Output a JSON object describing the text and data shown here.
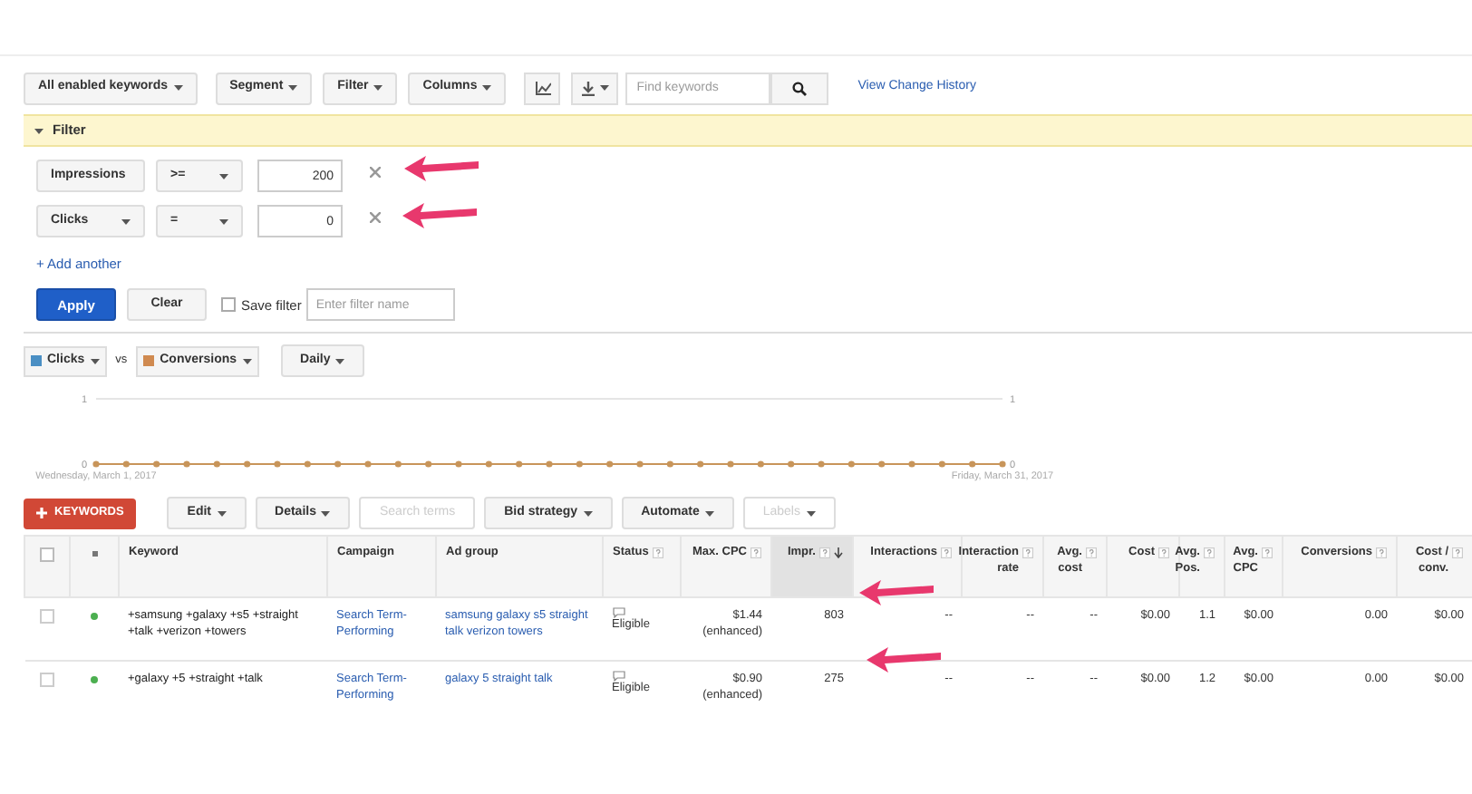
{
  "toolbar": {
    "view": "All enabled keywords",
    "buttons": [
      "Segment",
      "Filter",
      "Columns"
    ],
    "search": {
      "placeholder": "Find keywords"
    },
    "link": "View Change History"
  },
  "filter_panel": {
    "title": "Filter",
    "expanded": true,
    "rows": [
      {
        "field": "Impressions",
        "operator": ">=",
        "value": "200"
      },
      {
        "field": "Clicks",
        "operator": "=",
        "value": "0"
      }
    ],
    "add_link": "+ Add another",
    "apply": "Apply",
    "clear": "Clear",
    "save": {
      "label": "Save filter",
      "checked": false,
      "placeholder": "Enter filter name"
    }
  },
  "chart_controls": {
    "metric_1": {
      "label": "Clicks",
      "color": "#4a8fc4"
    },
    "vs": "vs",
    "metric_2": {
      "label": "Conversions",
      "color": "#d08a50"
    },
    "period": "Daily"
  },
  "chart_data": {
    "type": "line",
    "categories": [
      "Wednesday, March 1, 2017",
      null,
      null,
      null,
      null,
      null,
      null,
      null,
      null,
      null,
      null,
      null,
      null,
      null,
      null,
      null,
      null,
      null,
      null,
      null,
      null,
      null,
      null,
      null,
      null,
      null,
      null,
      null,
      null,
      null,
      "Friday, March 31, 2017"
    ],
    "series": [
      {
        "color": "#c8955a",
        "marker": "circle",
        "values": [
          0,
          0,
          0,
          0,
          0,
          0,
          0,
          0,
          0,
          0,
          0,
          0,
          0,
          0,
          0,
          0,
          0,
          0,
          0,
          0,
          0,
          0,
          0,
          0,
          0,
          0,
          0,
          0,
          0,
          0,
          0
        ]
      }
    ],
    "ylim": [
      0,
      1
    ],
    "yticks": [
      0,
      1
    ],
    "y2lim": [
      0,
      1
    ],
    "y2ticks": [
      0,
      1
    ]
  },
  "table_toolbar": [
    {
      "kind": "primary",
      "label": "KEYWORDS",
      "disabled": false
    },
    {
      "kind": "menu",
      "label": "Edit",
      "disabled": false
    },
    {
      "kind": "menu",
      "label": "Details",
      "disabled": false
    },
    {
      "kind": "plain",
      "label": "Search terms",
      "disabled": true
    },
    {
      "kind": "menu",
      "label": "Bid strategy",
      "disabled": false
    },
    {
      "kind": "menu",
      "label": "Automate",
      "disabled": false
    },
    {
      "kind": "menu",
      "label": "Labels",
      "disabled": true
    }
  ],
  "table": {
    "all_selected": false,
    "columns": [
      {
        "label": "Keyword",
        "help": false,
        "sorted": false
      },
      {
        "label": "Campaign",
        "help": false,
        "sorted": false
      },
      {
        "label": "Ad group",
        "help": false,
        "sorted": false
      },
      {
        "label": "Status",
        "help": true,
        "sorted": false
      },
      {
        "label": "Max. CPC",
        "help": true,
        "sorted": false
      },
      {
        "label": "Impr.",
        "help": true,
        "sorted": true
      },
      {
        "label": "Interactions",
        "help": true,
        "sorted": false
      },
      {
        "label": "Interaction rate",
        "help": true,
        "sorted": false
      },
      {
        "label": "Avg. cost",
        "help": true,
        "sorted": false
      },
      {
        "label": "Cost",
        "help": true,
        "sorted": false
      },
      {
        "label": "Avg. Pos.",
        "help": true,
        "sorted": false
      },
      {
        "label": "Avg. CPC",
        "help": true,
        "sorted": false
      },
      {
        "label": "Conversions",
        "help": true,
        "sorted": false
      },
      {
        "label": "Cost / conv.",
        "help": true,
        "sorted": false
      }
    ],
    "rows": [
      {
        "checked": false,
        "enabled": true,
        "cells": [
          "+samsung +galaxy +s5 +straight +talk +verizon +towers",
          "Search Term-Performing",
          "samsung galaxy s5 straight talk verizon towers",
          "Eligible",
          "$1.44 (enhanced)",
          "803",
          "--",
          "--",
          "--",
          "$0.00",
          "1.1",
          "$0.00",
          "0.00",
          "$0.00"
        ]
      },
      {
        "checked": false,
        "enabled": true,
        "cells": [
          "+galaxy +5 +straight +talk",
          "Search Term-Performing",
          "galaxy 5 straight talk",
          "Eligible",
          "$0.90 (enhanced)",
          "275",
          "--",
          "--",
          "--",
          "$0.00",
          "1.2",
          "$0.00",
          "0.00",
          "$0.00"
        ]
      }
    ]
  }
}
